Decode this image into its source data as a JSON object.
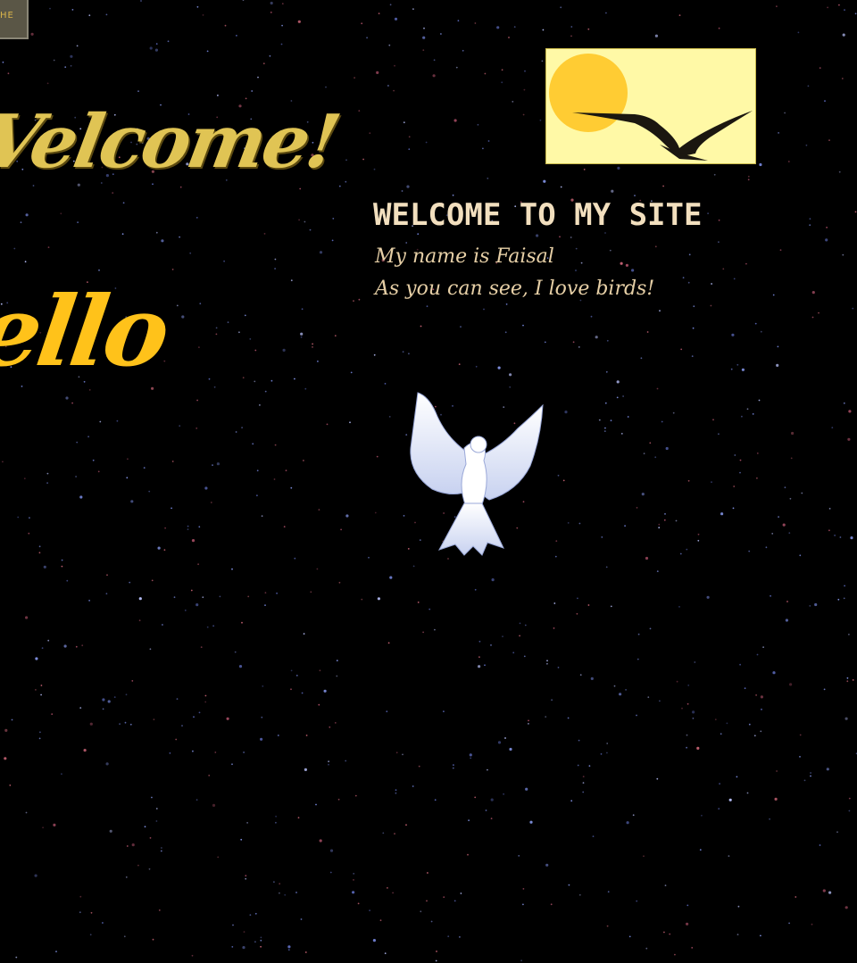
{
  "corner_tab": {
    "label": "HE"
  },
  "banners": {
    "welcome": "Velcome!",
    "hello": "ello"
  },
  "site": {
    "title": "WELCOME TO MY SITE",
    "intro_lines": [
      "My name is Faisal",
      "As you can see, I love birds!"
    ]
  },
  "images": {
    "sunset": "sunset-bird-icon",
    "dove": "white-dove-icon"
  },
  "colors": {
    "background": "#000000",
    "welcome_gold": "#e0c454",
    "hello_gold": "#ffc21a",
    "title_cream": "#f2dfbe",
    "sunset_sky": "#fff9a6",
    "sun": "#ffcc33"
  }
}
